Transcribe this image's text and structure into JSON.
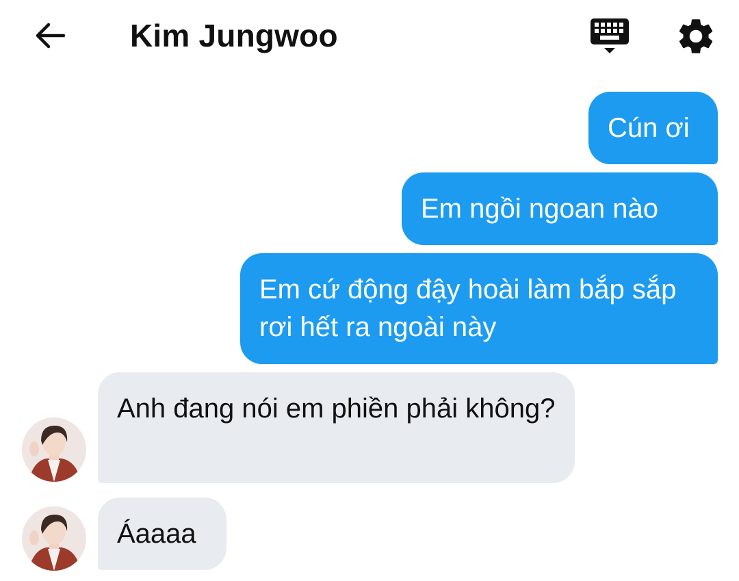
{
  "header": {
    "title": "Kim Jungwoo",
    "back_icon": "arrow-left-icon",
    "keyboard_icon": "keyboard-icon",
    "settings_icon": "gear-icon"
  },
  "messages": [
    {
      "direction": "sent",
      "text": "Cún ơi"
    },
    {
      "direction": "sent",
      "text": "Em ngồi ngoan nào"
    },
    {
      "direction": "sent",
      "text": "Em cứ động đậy hoài làm bắp sắp rơi hết ra ngoài này"
    },
    {
      "direction": "received",
      "text": "Anh đang nói em phiền phải không?"
    },
    {
      "direction": "received",
      "text": "Áaaaa"
    }
  ],
  "colors": {
    "sent_bubble": "#1d9bf0",
    "received_bubble": "#e8ecf0",
    "text_dark": "#111111",
    "text_light": "#ffffff"
  }
}
